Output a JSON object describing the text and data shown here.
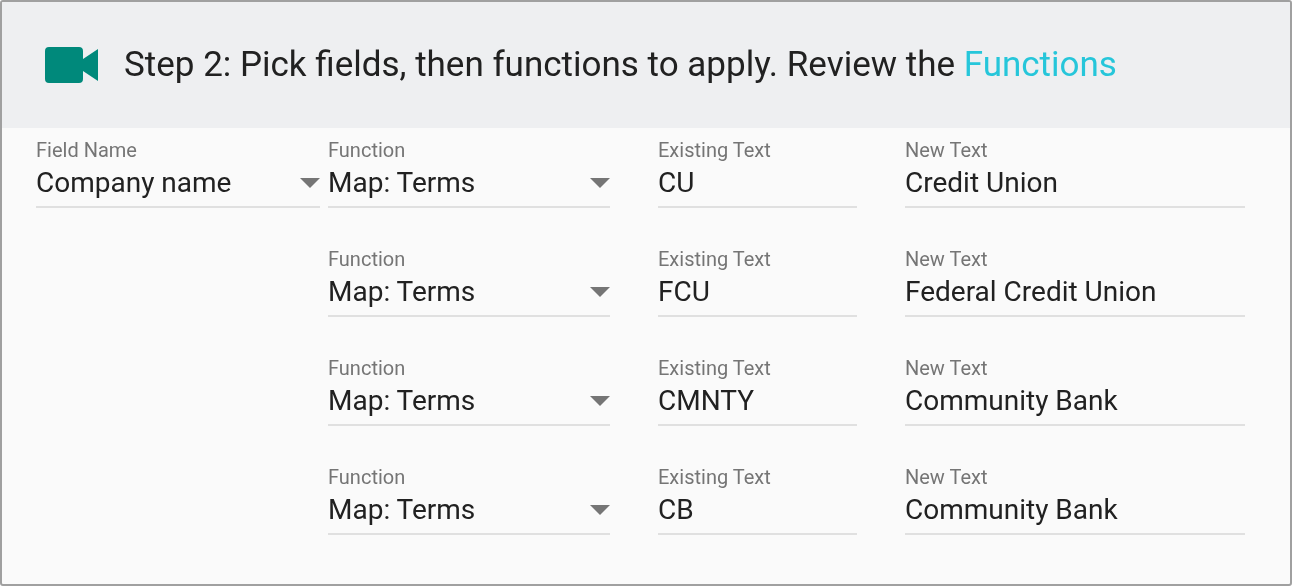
{
  "header": {
    "text": "Step 2: Pick fields, then functions to apply. Review the ",
    "link": "Functions"
  },
  "field": {
    "label": "Field Name",
    "value": "Company name"
  },
  "rows": [
    {
      "function_label": "Function",
      "function_value": "Map: Terms",
      "existing_label": "Existing Text",
      "existing_value": "CU",
      "new_label": "New Text",
      "new_value": "Credit Union"
    },
    {
      "function_label": "Function",
      "function_value": "Map: Terms",
      "existing_label": "Existing Text",
      "existing_value": "FCU",
      "new_label": "New Text",
      "new_value": "Federal Credit Union"
    },
    {
      "function_label": "Function",
      "function_value": "Map: Terms",
      "existing_label": "Existing Text",
      "existing_value": "CMNTY",
      "new_label": "New Text",
      "new_value": "Community Bank"
    },
    {
      "function_label": "Function",
      "function_value": "Map: Terms",
      "existing_label": "Existing Text",
      "existing_value": "CB",
      "new_label": "New Text",
      "new_value": "Community Bank"
    }
  ]
}
